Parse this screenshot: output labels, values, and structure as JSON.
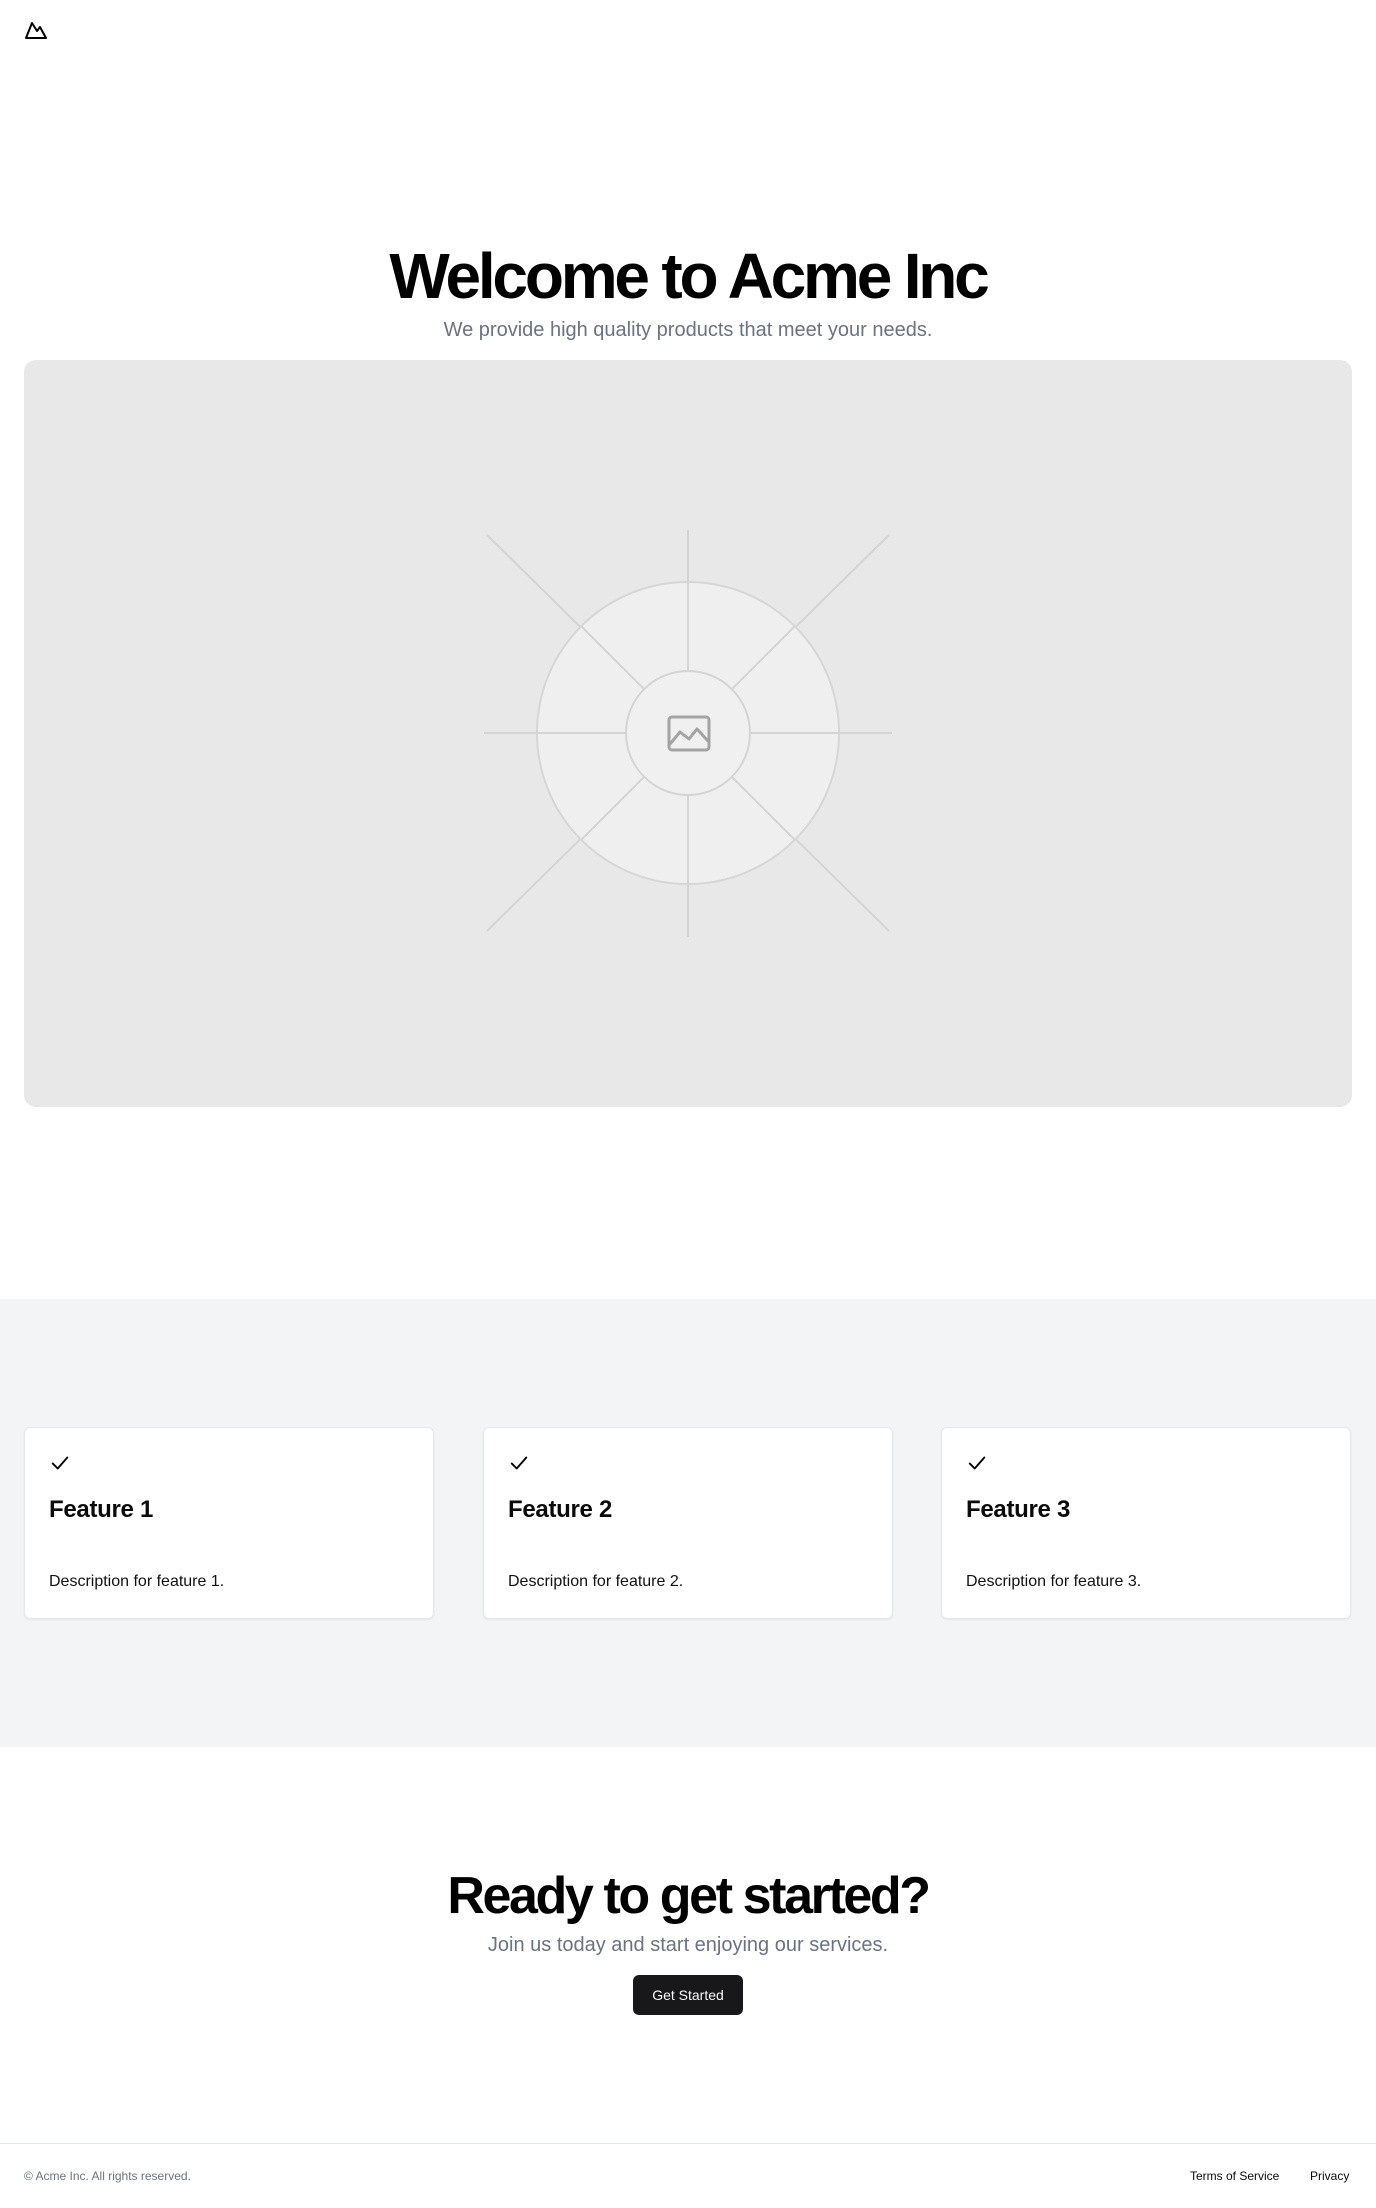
{
  "header": {
    "logo_icon": "mountain-icon"
  },
  "hero": {
    "title": "Welcome to Acme Inc",
    "subtitle": "We provide high quality products that meet your needs.",
    "image_icon": "image-placeholder-icon"
  },
  "features": {
    "items": [
      {
        "icon": "check-icon",
        "title": "Feature 1",
        "description": "Description for feature 1."
      },
      {
        "icon": "check-icon",
        "title": "Feature 2",
        "description": "Description for feature 2."
      },
      {
        "icon": "check-icon",
        "title": "Feature 3",
        "description": "Description for feature 3."
      }
    ]
  },
  "cta": {
    "title": "Ready to get started?",
    "subtitle": "Join us today and start enjoying our services.",
    "button_label": "Get Started"
  },
  "footer": {
    "copyright": "© Acme Inc. All rights reserved.",
    "links": [
      "Terms of Service",
      "Privacy"
    ]
  },
  "colors": {
    "primary_button": "#18181b",
    "muted_text": "#6b7280",
    "features_background": "#f3f4f6",
    "placeholder_background": "#e8e8e8"
  }
}
